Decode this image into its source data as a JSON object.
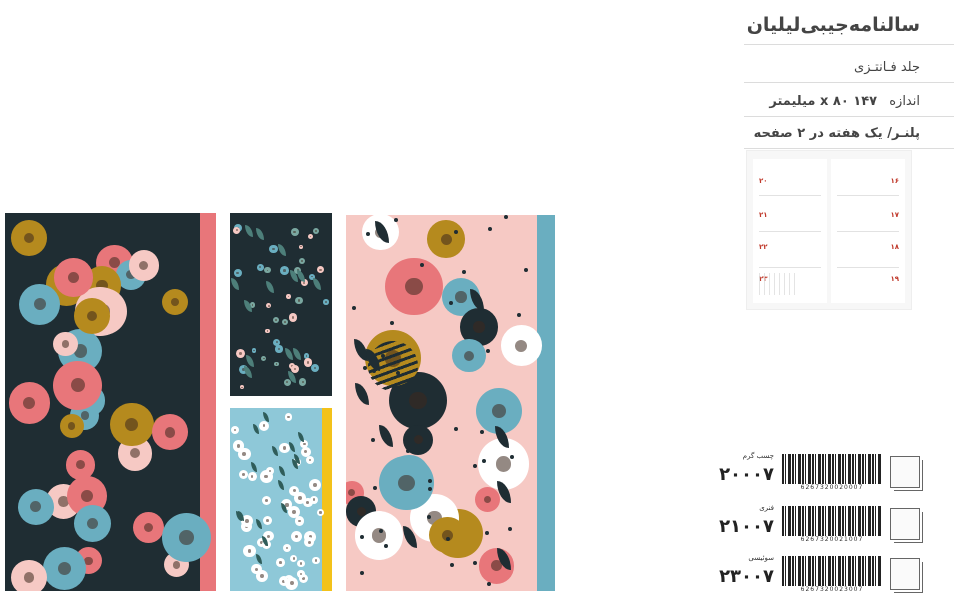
{
  "product": {
    "title": "سالنامه‌جیبی‌لیلیان",
    "cover_type": "جلد فـانتـزی",
    "size_label": "اندازه",
    "size_value": "۱۴۷ x ۸۰ میلیمتر",
    "layout": "پلنـر/ یک هفته در ۲ صفحه"
  },
  "planner_preview": {
    "day_numbers": [
      "۲۰",
      "۲۱",
      "۲۲",
      "۲۳",
      "۱۶",
      "۱۷",
      "۱۸",
      "۱۹"
    ]
  },
  "variants": [
    {
      "binding": "چسب گرم",
      "barcode": "6267320020007",
      "price": "۲۰۰۰۷"
    },
    {
      "binding": "فنری",
      "barcode": "6267320021007",
      "price": "۲۱۰۰۷"
    },
    {
      "binding": "سوئیسی",
      "barcode": "6267320023007",
      "price": "۲۳۰۰۷"
    }
  ],
  "colors": {
    "navy": "#1f2d33",
    "pink": "#e8767a",
    "light_pink": "#f6c9c4",
    "teal": "#6aaec0",
    "mustard": "#b58a1e",
    "yellow": "#f3c21a",
    "sky": "#8ec8d8"
  }
}
